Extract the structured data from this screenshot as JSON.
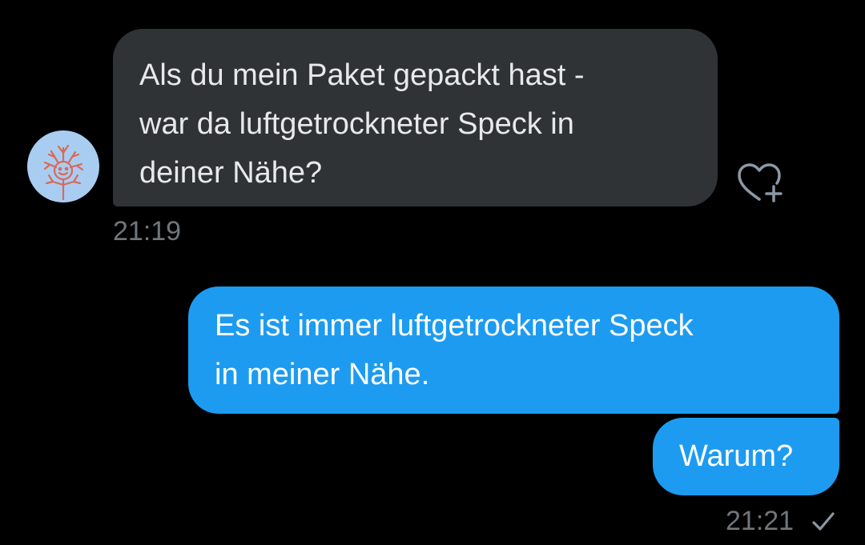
{
  "conversation": {
    "incoming": {
      "avatar_icon": "doodle-avatar-icon",
      "text": "Als du mein Paket gepackt hast -\nwar da luftgetrockneter Speck in\ndeiner Nähe?",
      "time": "21:19",
      "reaction_icon": "add-reaction-heart-icon",
      "bubble_color": "#2f3336"
    },
    "outgoing": [
      {
        "text": "Es ist immer luftgetrockneter Speck\nin meiner Nähe."
      },
      {
        "text": "Warum?"
      }
    ],
    "outgoing_time": "21:21",
    "read_icon": "checkmark-icon",
    "outgoing_bubble_color": "#1d9bf0"
  }
}
